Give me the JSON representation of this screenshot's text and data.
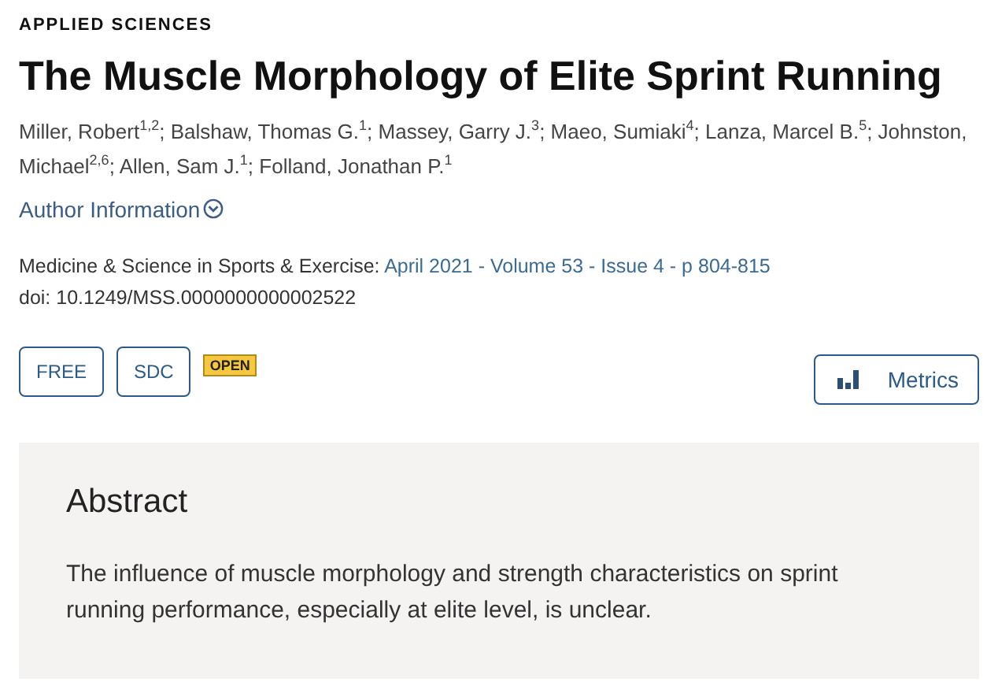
{
  "section_label": "APPLIED SCIENCES",
  "title": "The Muscle Morphology of Elite Sprint Running",
  "authors": "Miller, Robert$^{1,2}$; Balshaw, Thomas G.$^{1}$; Massey, Garry J.$^{3}$; Maeo, Sumiaki$^{4}$; Lanza, Marcel B.$^{5}$; Johnston, Michael$^{2,6}$; Allen, Sam J.$^{1}$; Folland, Jonathan P.$^{1}$",
  "author_info": {
    "label": "Author Information",
    "expanded": false
  },
  "citation": {
    "journal": "Medicine & Science in Sports & Exercise:",
    "issue_link": "April 2021 - Volume 53 - Issue 4 - p 804-815",
    "doi": "doi: 10.1249/MSS.0000000000002522"
  },
  "badges": [
    {
      "label": "FREE",
      "kind": "button"
    },
    {
      "label": "SDC",
      "kind": "button"
    },
    {
      "label": "OPEN",
      "kind": "tag"
    }
  ],
  "metrics_button": "Metrics",
  "abstract": {
    "heading": "Abstract",
    "text": "The influence of muscle morphology and strength characteristics on sprint running performance, especially at elite level, is unclear."
  }
}
